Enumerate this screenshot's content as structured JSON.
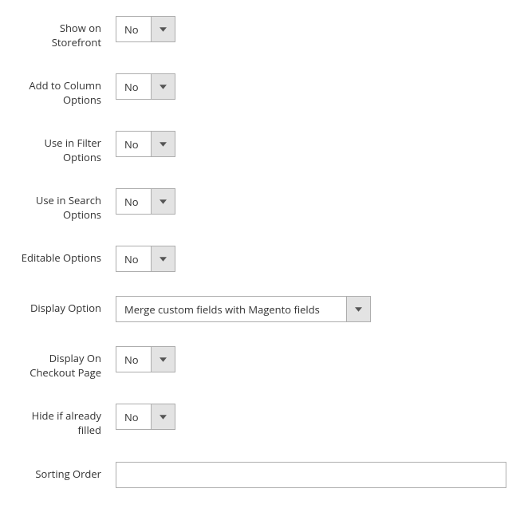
{
  "fields": {
    "show_on_storefront": {
      "label": "Show on Storefront",
      "value": "No"
    },
    "add_to_column": {
      "label": "Add to Column Options",
      "value": "No"
    },
    "use_in_filter": {
      "label": "Use in Filter Options",
      "value": "No"
    },
    "use_in_search": {
      "label": "Use in Search Options",
      "value": "No"
    },
    "editable_options": {
      "label": "Editable Options",
      "value": "No"
    },
    "display_option": {
      "label": "Display Option",
      "value": "Merge custom fields with Magento fields"
    },
    "display_on_checkout": {
      "label": "Display On Checkout Page",
      "value": "No"
    },
    "hide_if_filled": {
      "label": "Hide if already filled",
      "value": "No"
    },
    "sorting_order": {
      "label": "Sorting Order",
      "value": ""
    }
  }
}
